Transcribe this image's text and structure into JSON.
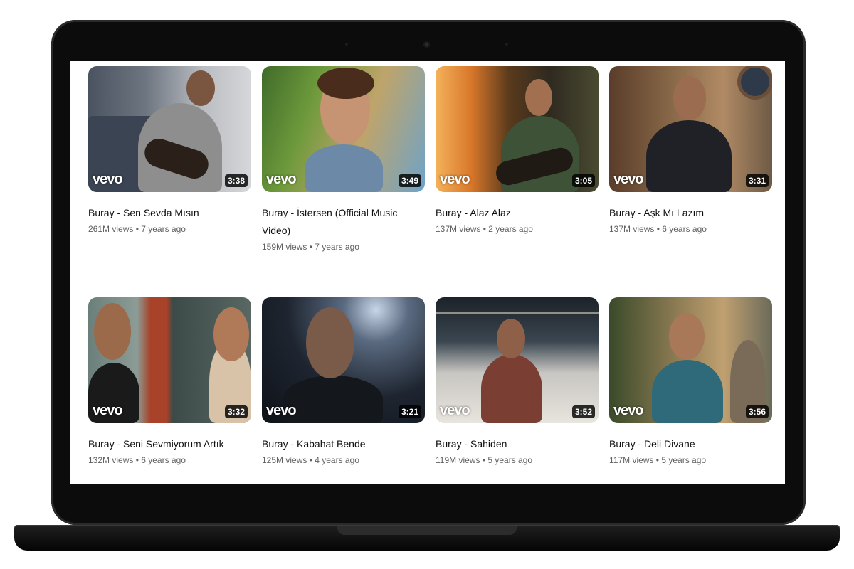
{
  "videos": [
    {
      "title": "Buray - Sen Sevda Mısın",
      "views": "261M views",
      "age": "7 years ago",
      "duration": "3:38",
      "badge": "vevo"
    },
    {
      "title": "Buray - İstersen (Official Music Video)",
      "views": "159M views",
      "age": "7 years ago",
      "duration": "3:49",
      "badge": "vevo"
    },
    {
      "title": "Buray - Alaz Alaz",
      "views": "137M views",
      "age": "2 years ago",
      "duration": "3:05",
      "badge": "vevo"
    },
    {
      "title": "Buray - Aşk Mı Lazım",
      "views": "137M views",
      "age": "6 years ago",
      "duration": "3:31",
      "badge": "vevo"
    },
    {
      "title": "Buray - Seni Sevmiyorum Artık",
      "views": "132M views",
      "age": "6 years ago",
      "duration": "3:32",
      "badge": "vevo"
    },
    {
      "title": "Buray - Kabahat Bende",
      "views": "125M views",
      "age": "4 years ago",
      "duration": "3:21",
      "badge": "vevo"
    },
    {
      "title": "Buray - Sahiden",
      "views": "119M views",
      "age": "5 years ago",
      "duration": "3:52",
      "badge": "vevo"
    },
    {
      "title": "Buray - Deli Divane",
      "views": "117M views",
      "age": "5 years ago",
      "duration": "3:56",
      "badge": "vevo"
    }
  ],
  "meta_separator": " • "
}
